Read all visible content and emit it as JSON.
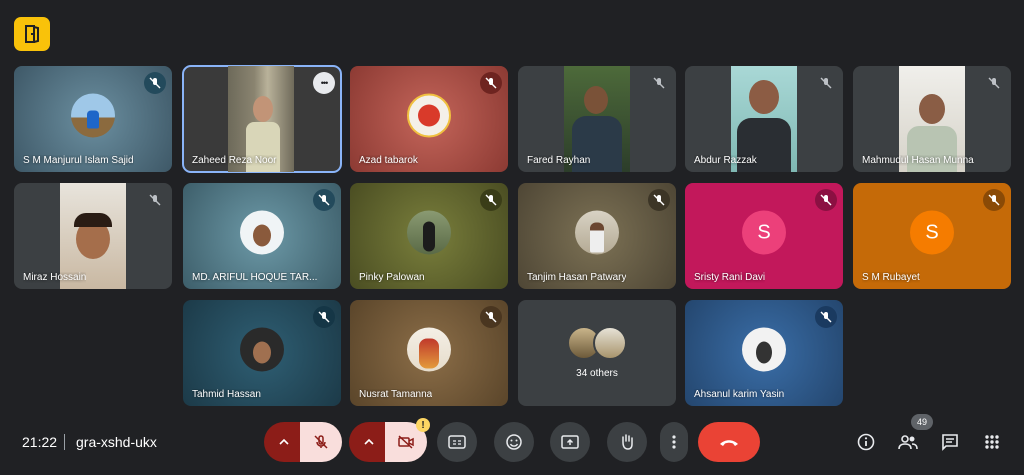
{
  "participants": [
    {
      "name": "S M Manjurul Islam Sajid",
      "muted": true
    },
    {
      "name": "Zaheed Reza Noor",
      "muted": false,
      "more_label": "•••"
    },
    {
      "name": "Azad tabarok",
      "muted": true
    },
    {
      "name": "Fared Rayhan",
      "muted": true
    },
    {
      "name": "Abdur Razzak",
      "muted": true
    },
    {
      "name": "Mahmudul Hasan Munna",
      "muted": true
    },
    {
      "name": "Miraz Hossain",
      "muted": true
    },
    {
      "name": "MD. ARIFUL HOQUE TAR...",
      "muted": true
    },
    {
      "name": "Pinky Palowan",
      "muted": true
    },
    {
      "name": "Tanjim Hasan Patwary",
      "muted": true
    },
    {
      "name": "Sristy Rani Davi",
      "muted": true,
      "initial": "S",
      "color": "#ec407a"
    },
    {
      "name": "S M Rubayet",
      "muted": true,
      "initial": "S",
      "color": "#f57c00"
    },
    {
      "name": "Tahmid Hassan",
      "muted": true
    },
    {
      "name": "Nusrat Tamanna",
      "muted": true
    },
    {
      "name": "Ahsanul karim Yasin",
      "muted": true
    }
  ],
  "others": {
    "label": "34 others"
  },
  "bottom_bar": {
    "time": "21:22",
    "meeting_code": "gra-xshd-ukx",
    "camera_warning": "!",
    "people_count": "49"
  },
  "colors": {
    "background": "#202124",
    "end_call": "#ea4335",
    "muted_control": "#f9dedc"
  }
}
